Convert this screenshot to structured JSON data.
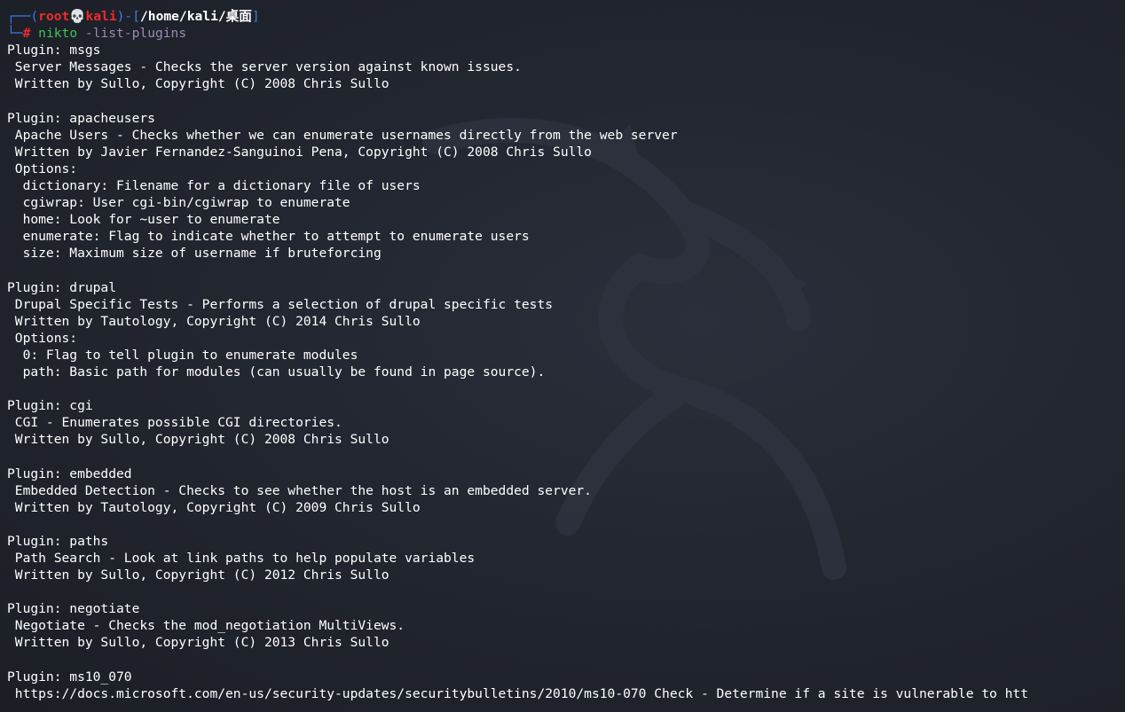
{
  "prompt": {
    "box_top": "┌──(",
    "user": "root",
    "skull": "💀",
    "host": "kali",
    "close_open": ")-[",
    "path": "/home/kali/桌面",
    "close_bracket": "]",
    "box_bottom": "└─",
    "hash": "#",
    "command": "nikto",
    "option": "-list-plugins"
  },
  "output": {
    "lines": [
      "Plugin: msgs",
      " Server Messages - Checks the server version against known issues.",
      " Written by Sullo, Copyright (C) 2008 Chris Sullo",
      "",
      "Plugin: apacheusers",
      " Apache Users - Checks whether we can enumerate usernames directly from the web server",
      " Written by Javier Fernandez-Sanguinoi Pena, Copyright (C) 2008 Chris Sullo",
      " Options:",
      "  dictionary: Filename for a dictionary file of users",
      "  cgiwrap: User cgi-bin/cgiwrap to enumerate",
      "  home: Look for ~user to enumerate",
      "  enumerate: Flag to indicate whether to attempt to enumerate users",
      "  size: Maximum size of username if bruteforcing",
      "",
      "Plugin: drupal",
      " Drupal Specific Tests - Performs a selection of drupal specific tests",
      " Written by Tautology, Copyright (C) 2014 Chris Sullo",
      " Options:",
      "  0: Flag to tell plugin to enumerate modules",
      "  path: Basic path for modules (can usually be found in page source).",
      "",
      "Plugin: cgi",
      " CGI - Enumerates possible CGI directories.",
      " Written by Sullo, Copyright (C) 2008 Chris Sullo",
      "",
      "Plugin: embedded",
      " Embedded Detection - Checks to see whether the host is an embedded server.",
      " Written by Tautology, Copyright (C) 2009 Chris Sullo",
      "",
      "Plugin: paths",
      " Path Search - Look at link paths to help populate variables",
      " Written by Sullo, Copyright (C) 2012 Chris Sullo",
      "",
      "Plugin: negotiate",
      " Negotiate - Checks the mod_negotiation MultiViews.",
      " Written by Sullo, Copyright (C) 2013 Chris Sullo",
      "",
      "Plugin: ms10_070",
      " https://docs.microsoft.com/en-us/security-updates/securitybulletins/2010/ms10-070 Check - Determine if a site is vulnerable to htt"
    ]
  },
  "colors": {
    "background": "#1e222a",
    "prompt_frame": "#3b7ce8",
    "user_host": "#ef2b2b",
    "command": "#3ec25a",
    "option": "#9a8ab8",
    "text": "#ffffff"
  }
}
